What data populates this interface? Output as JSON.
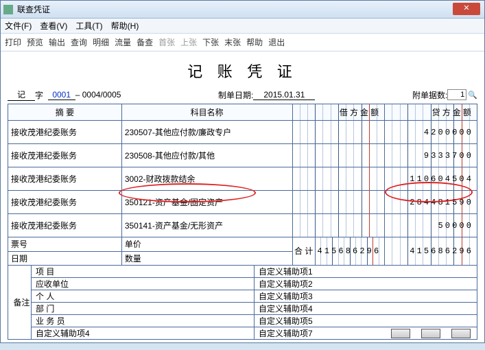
{
  "window": {
    "title": "联查凭证"
  },
  "menu": {
    "file": "文件(F)",
    "view": "查看(V)",
    "tools": "工具(T)",
    "help": "帮助(H)"
  },
  "toolbar": {
    "print": "打印",
    "preview": "预览",
    "output": "输出",
    "query": "查询",
    "detail": "明细",
    "flow": "流量",
    "audit": "备查",
    "first": "首张",
    "prev": "上张",
    "next": "下张",
    "last": "末张",
    "helpbtn": "帮助",
    "exit": "退出"
  },
  "doc": {
    "title": "记 账 凭 证",
    "word_label": "记",
    "word_suffix": "字",
    "seq1": "0001",
    "dash": "–",
    "seq2": "0004/0005",
    "date_label": "制单日期:",
    "date": "2015.01.31",
    "att_label": "附单据数:",
    "att_value": "1"
  },
  "headers": {
    "summary": "摘 要",
    "subject": "科目名称",
    "debit": "借方金额",
    "credit": "贷方金额"
  },
  "rows": [
    {
      "summary": "接收茂港纪委账务",
      "subject": "230507-其他应付款/廉政专户",
      "debit": "",
      "credit": "4200000"
    },
    {
      "summary": "接收茂港纪委账务",
      "subject": "230508-其他应付款/其他",
      "debit": "",
      "credit": "9333700"
    },
    {
      "summary": "接收茂港纪委账务",
      "subject": "3002-财政拨款结余",
      "debit": "",
      "credit": "110604504"
    },
    {
      "summary": "接收茂港纪委账务",
      "subject": "350121-资产基金/固定资产",
      "debit": "",
      "credit": "284481590"
    },
    {
      "summary": "接收茂港纪委账务",
      "subject": "350141-资产基金/无形资产",
      "debit": "",
      "credit": "50000"
    }
  ],
  "mid": {
    "ticket": "票号",
    "price": "单价",
    "date": "日期",
    "qty": "数量",
    "total": "合  计",
    "debit_total": "415686296",
    "credit_total": "415686296"
  },
  "remark": {
    "label": "备注",
    "left": [
      "项   目",
      "应收单位",
      "个   人",
      "部   门",
      "业 务 员",
      "自定义辅助项4"
    ],
    "right": [
      "自定义辅助项1",
      "自定义辅助项2",
      "自定义辅助项3",
      "自定义辅助项4",
      "自定义辅助项5",
      "自定义辅助项7"
    ]
  }
}
